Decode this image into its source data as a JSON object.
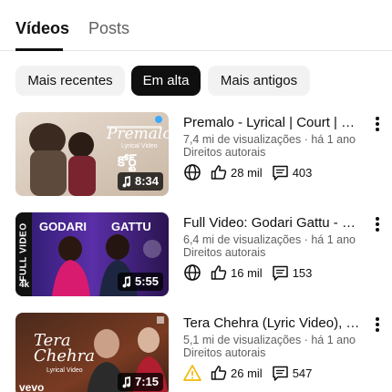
{
  "tabs": {
    "videos": "Vídeos",
    "posts": "Posts"
  },
  "chips": [
    "Mais recentes",
    "Em alta",
    "Mais antigos"
  ],
  "videos": [
    {
      "title": "Premalo - Lyrical | Court | Priyadarshi",
      "views": "7,4 mi de visualizações · há 1 ano",
      "license": "Direitos autorais",
      "duration": "8:34",
      "likes": "28 mil",
      "comments": "403",
      "thumb_text": "Premalo",
      "thumb_sub": "Lyrical Video",
      "thumb_logo": "కోర్ట్",
      "status_icon": "globe-icon"
    },
    {
      "title": "Full Video: Godari Gattu - Sankranthiki Vasthunam",
      "views": "6,4 mi de visualizações · há 1 ano",
      "license": "Direitos autorais",
      "duration": "5:55",
      "likes": "16 mil",
      "comments": "153",
      "thumb_text_left": "GODARI",
      "thumb_text_right": "GATTU",
      "thumb_side": "FULL VIDEO",
      "thumb_badge": "4k",
      "status_icon": "globe-icon"
    },
    {
      "title": "Tera Chehra (Lyric Video), Sanam Teri Kasam",
      "views": "5,1 mi de visualizações · há 1 ano",
      "license": "Direitos autorais",
      "duration": "7:15",
      "likes": "26 mil",
      "comments": "547",
      "thumb_text": "Tera Chehra",
      "thumb_sub": "Lyrical Video",
      "thumb_badge": "vevo",
      "status_icon": "warning-icon"
    }
  ],
  "colors": {
    "accent": "#0f0f0f",
    "muted": "#606060",
    "chip_bg": "#f2f2f2",
    "warning": "#f2b705"
  }
}
